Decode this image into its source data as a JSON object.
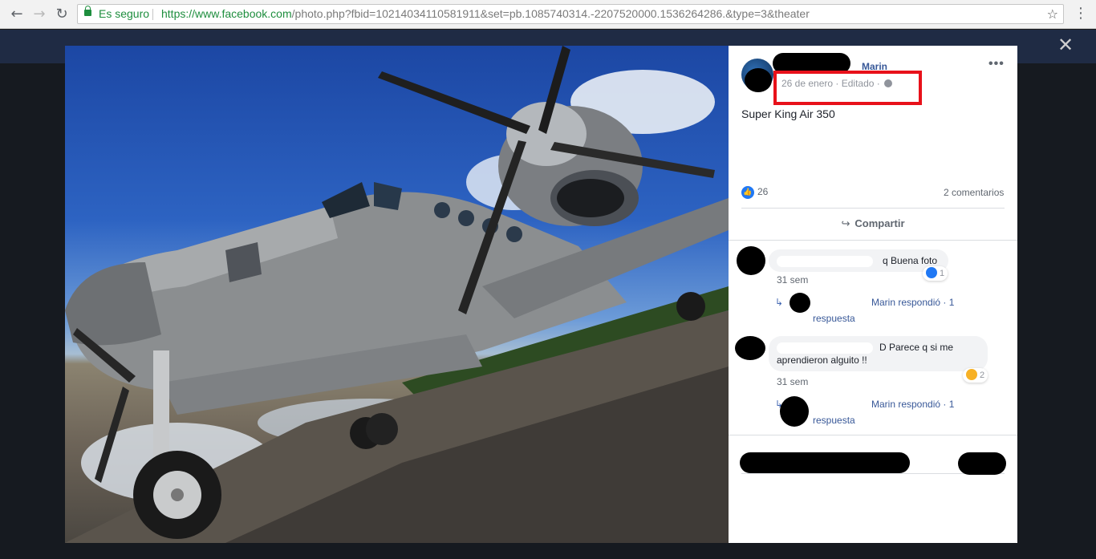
{
  "browser": {
    "secure_label": "Es seguro",
    "url_host": "https://www.facebook.com",
    "url_path": "/photo.php?fbid=10214034110581911&set=pb.1085740314.-2207520000.1536264286.&type=3&theater",
    "back_icon": "back-arrow-icon",
    "forward_icon": "forward-arrow-icon",
    "reload_icon": "reload-icon",
    "star_icon": "bookmark-star-icon",
    "menu_icon": "kebab-menu-icon"
  },
  "viewer": {
    "close_icon": "close-icon"
  },
  "post": {
    "author_visible": "Marin",
    "date": "26 de enero",
    "edited": "Editado",
    "caption": "Super King Air 350",
    "like_count": "26",
    "comment_count": "2 comentarios",
    "share_label": "Compartir",
    "highlight_color": "#e8111a"
  },
  "comments": [
    {
      "text": "q Buena foto",
      "time": "31 sem",
      "reaction_count": "1",
      "reply_author": "Marin respondió",
      "reply_sep": "·",
      "reply_count": "1",
      "reply_label": "respuesta"
    },
    {
      "text_line1": "D Parece q si me",
      "text_line2": "aprendieron alguito !!",
      "time": "31 sem",
      "reaction_count": "2",
      "reply_author": "Marin respondió",
      "reply_sep": "·",
      "reply_count": "1",
      "reply_label": "respuesta"
    }
  ]
}
